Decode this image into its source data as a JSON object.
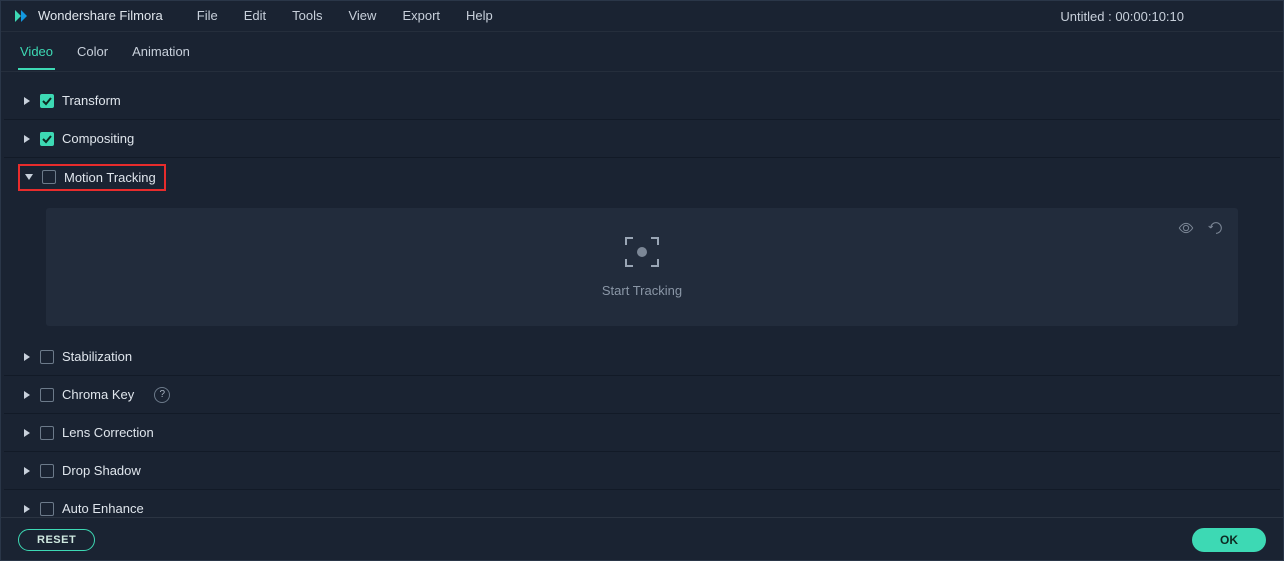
{
  "app_name": "Wondershare Filmora",
  "menu": [
    "File",
    "Edit",
    "Tools",
    "View",
    "Export",
    "Help"
  ],
  "project_title": "Untitled : 00:00:10:10",
  "tabs": [
    {
      "label": "Video",
      "active": true
    },
    {
      "label": "Color",
      "active": false
    },
    {
      "label": "Animation",
      "active": false
    }
  ],
  "sections": {
    "transform": {
      "label": "Transform",
      "checked": true,
      "expanded": false
    },
    "compositing": {
      "label": "Compositing",
      "checked": true,
      "expanded": false
    },
    "motion_tracking": {
      "label": "Motion Tracking",
      "checked": false,
      "expanded": true,
      "start_label": "Start Tracking"
    },
    "stabilization": {
      "label": "Stabilization",
      "checked": false,
      "expanded": false
    },
    "chroma_key": {
      "label": "Chroma Key",
      "checked": false,
      "expanded": false,
      "help": true
    },
    "lens_correction": {
      "label": "Lens Correction",
      "checked": false,
      "expanded": false
    },
    "drop_shadow": {
      "label": "Drop Shadow",
      "checked": false,
      "expanded": false
    },
    "auto_enhance": {
      "label": "Auto Enhance",
      "checked": false,
      "expanded": false
    }
  },
  "buttons": {
    "reset": "RESET",
    "ok": "OK"
  }
}
